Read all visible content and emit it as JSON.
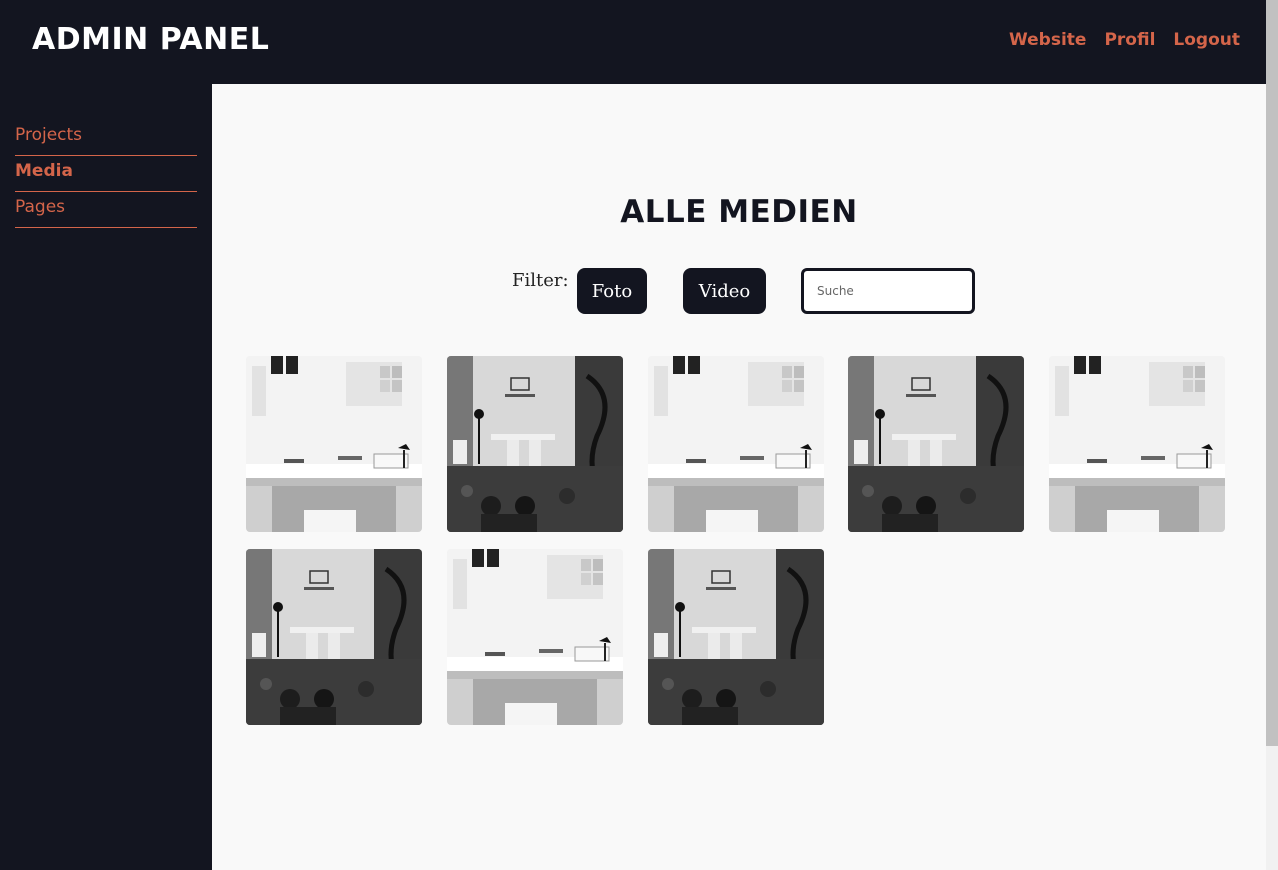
{
  "header": {
    "brand": "ADMIN PANEL",
    "nav": [
      {
        "label": "Website"
      },
      {
        "label": "Profil"
      },
      {
        "label": "Logout"
      }
    ]
  },
  "sidebar": {
    "items": [
      {
        "label": "Projects",
        "active": false
      },
      {
        "label": "Media",
        "active": true
      },
      {
        "label": "Pages",
        "active": false
      }
    ]
  },
  "main": {
    "title": "ALLE MEDIEN",
    "filter": {
      "label": "Filter:",
      "buttons": [
        {
          "label": "Foto"
        },
        {
          "label": "Video"
        }
      ],
      "search_placeholder": "Suche"
    },
    "media": [
      {
        "variant": "light"
      },
      {
        "variant": "dark"
      },
      {
        "variant": "light"
      },
      {
        "variant": "dark"
      },
      {
        "variant": "light"
      },
      {
        "variant": "dark"
      },
      {
        "variant": "light"
      },
      {
        "variant": "dark"
      }
    ]
  },
  "colors": {
    "dark_bg": "#131520",
    "accent": "#d4654a",
    "content_bg": "#f9f9f9"
  }
}
